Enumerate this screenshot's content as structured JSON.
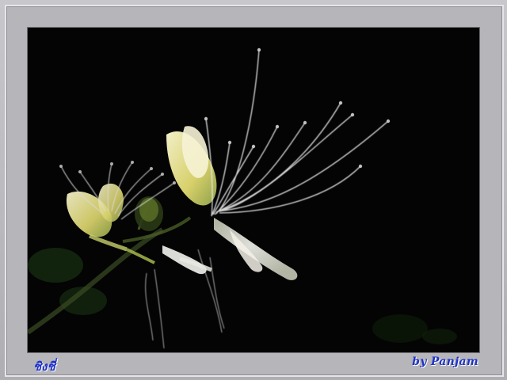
{
  "photo": {
    "subject": "white-flower-icon",
    "background_color": "#040404",
    "accent_color": "#c9d27a"
  },
  "captions": {
    "left": "ชิงชี่",
    "right": "by  Panjam"
  },
  "colors": {
    "frame": "#b9b9bd",
    "caption_text": "#1f33c9"
  }
}
